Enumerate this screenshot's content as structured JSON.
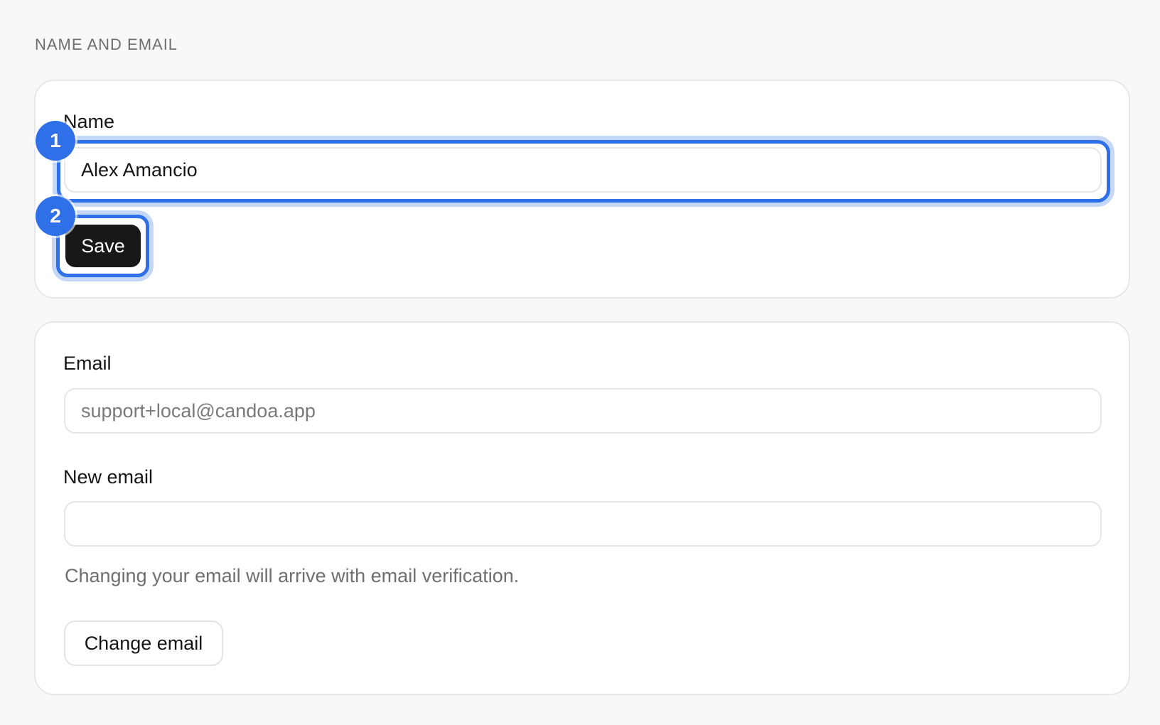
{
  "section": {
    "heading": "NAME AND EMAIL"
  },
  "name_card": {
    "label": "Name",
    "value": "Alex Amancio",
    "save_label": "Save"
  },
  "email_card": {
    "email_label": "Email",
    "email_value": "support+local@candoa.app",
    "new_email_label": "New email",
    "new_email_value": "",
    "help_text": "Changing your email will arrive with email verification.",
    "change_email_label": "Change email"
  },
  "annotations": [
    {
      "number": "1",
      "target": "name-input"
    },
    {
      "number": "2",
      "target": "save-button"
    }
  ],
  "colors": {
    "accent": "#2f6fe8",
    "primary_button": "#181818",
    "muted_text": "#6f6f6f",
    "card_border": "#e7e7e7"
  }
}
